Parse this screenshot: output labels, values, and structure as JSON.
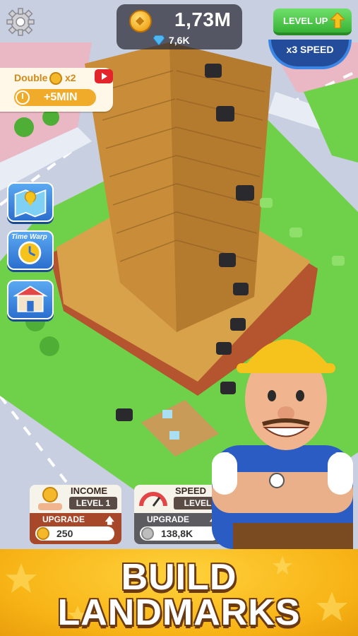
{
  "hud": {
    "coins": "1,73M",
    "gems": "7,6K",
    "level_up_label": "LEVEL UP",
    "speed_label": "x3 SPEED"
  },
  "double_bonus": {
    "title": "Double",
    "multiplier": "x2",
    "duration": "+5MIN"
  },
  "side_buttons": {
    "time_warp_label": "Time Warp"
  },
  "cards": {
    "income": {
      "title": "INCOME",
      "level": "LEVEL 1",
      "upgrade_label": "UPGRADE",
      "cost": "250"
    },
    "speed": {
      "title": "SPEED",
      "level": "LEVEL",
      "upgrade_label": "UPGRADE",
      "cost": "138,8K"
    }
  },
  "banner": {
    "line1": "BUILD",
    "line2": "LANDMARKS"
  },
  "colors": {
    "grass": "#6fd04a",
    "road": "#c9d1e2",
    "building": "#d8a24a",
    "banner": "#f7b315",
    "accent_green": "#38b336",
    "accent_blue": "#2c6fcf"
  }
}
